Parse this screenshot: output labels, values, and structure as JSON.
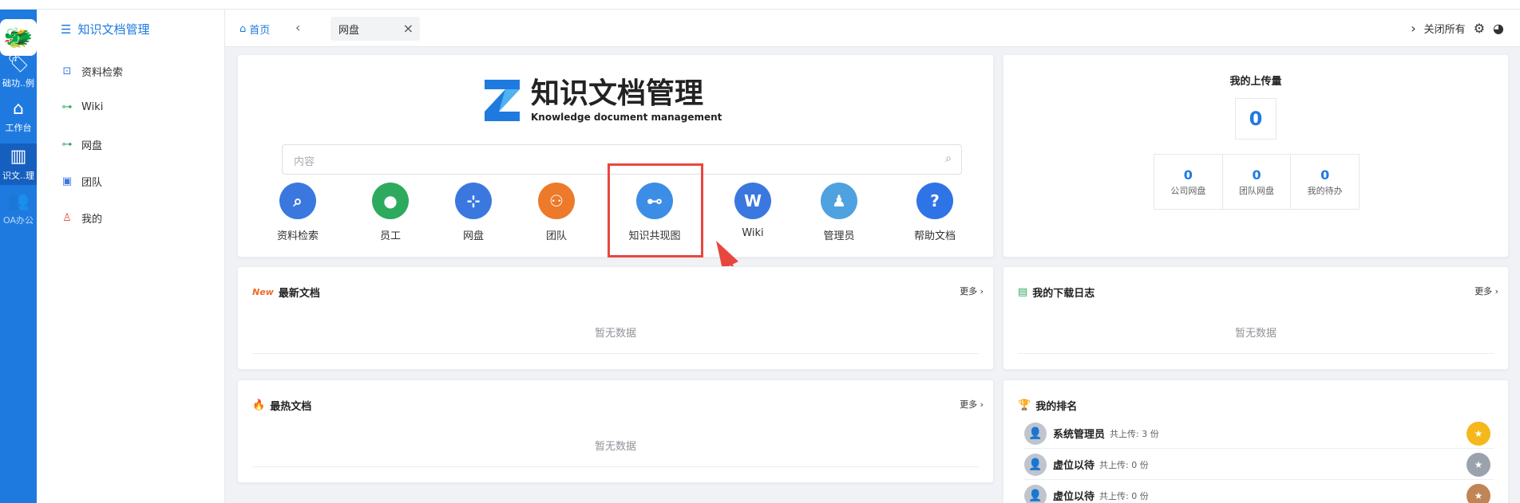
{
  "rail": {
    "items": [
      {
        "label": "础功..例"
      },
      {
        "label": "工作台"
      },
      {
        "label": "识文..理"
      },
      {
        "label": "OA办公"
      }
    ]
  },
  "menu": {
    "header": "知识文档管理",
    "items": [
      {
        "label": "资料检索"
      },
      {
        "label": "Wiki"
      },
      {
        "label": "网盘"
      },
      {
        "label": "团队"
      },
      {
        "label": "我的"
      }
    ]
  },
  "tabs": {
    "home": "首页",
    "active": "网盘",
    "close_all": "关闭所有"
  },
  "hero": {
    "title": "知识文档管理",
    "subtitle": "Knowledge document management",
    "search_placeholder": "内容",
    "quick": [
      {
        "label": "资料检索",
        "color": "#3a78e0",
        "icon": "search-icon"
      },
      {
        "label": "员工",
        "color": "#2eaa5e",
        "icon": "person-icon"
      },
      {
        "label": "网盘",
        "color": "#3a78e0",
        "icon": "network-icon"
      },
      {
        "label": "团队",
        "color": "#ec7a2a",
        "icon": "team-icon"
      },
      {
        "label": "知识共现图",
        "color": "#3c8de6",
        "icon": "graph-icon"
      },
      {
        "label": "Wiki",
        "color": "#3a78e0",
        "icon": "wiki-icon"
      },
      {
        "label": "管理员",
        "color": "#4fa2e0",
        "icon": "admin-icon"
      },
      {
        "label": "帮助文档",
        "color": "#2f74e6",
        "icon": "help-icon"
      }
    ]
  },
  "upload_stats": {
    "title": "我的上传量",
    "total": "0",
    "cells": [
      {
        "num": "0",
        "label": "公司网盘"
      },
      {
        "num": "0",
        "label": "团队网盘"
      },
      {
        "num": "0",
        "label": "我的待办"
      }
    ]
  },
  "latest_docs": {
    "title": "最新文档",
    "more": "更多",
    "empty": "暂无数据",
    "badge": "New"
  },
  "hot_docs": {
    "title": "最热文档",
    "more": "更多",
    "empty": "暂无数据"
  },
  "download_log": {
    "title": "我的下载日志",
    "more": "更多",
    "empty": "暂无数据"
  },
  "ranking": {
    "title": "我的排名",
    "items": [
      {
        "name": "系统管理员",
        "uploads": "共上传: 3 份",
        "medal_color": "#f5b81c"
      },
      {
        "name": "虚位以待",
        "uploads": "共上传: 0 份",
        "medal_color": "#9aa3ad"
      },
      {
        "name": "虚位以待",
        "uploads": "共上传: 0 份",
        "medal_color": "#c08455"
      }
    ]
  },
  "colors": {
    "accent": "#1f7ae0",
    "highlight": "#e8473f"
  }
}
